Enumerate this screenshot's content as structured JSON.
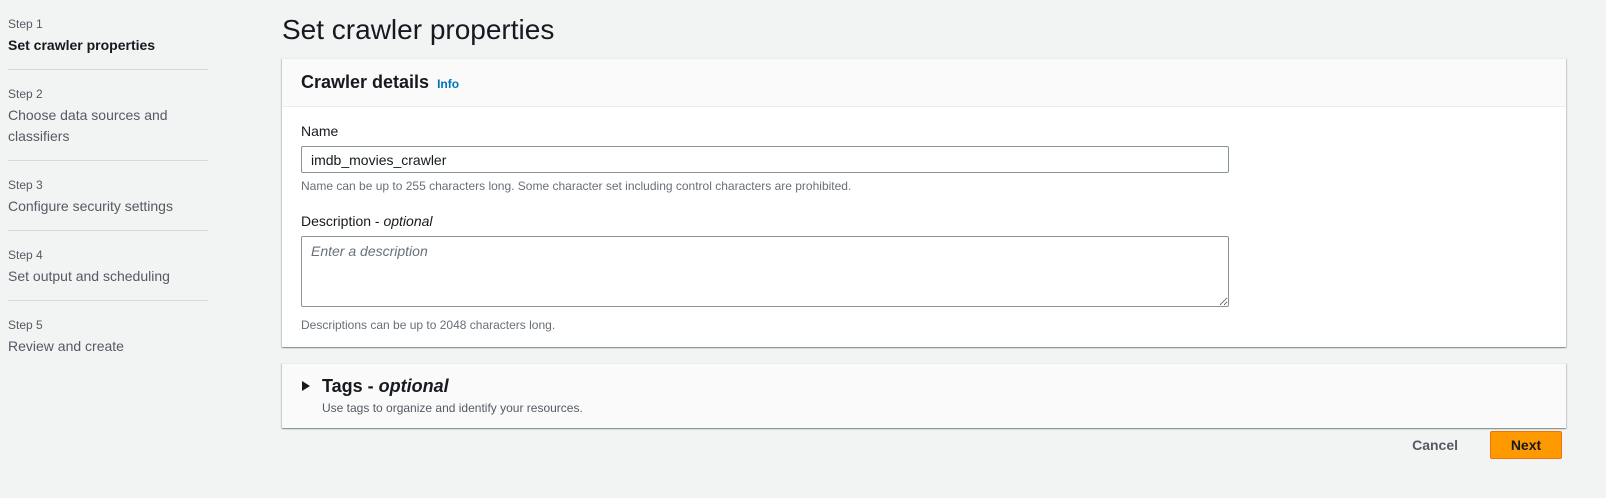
{
  "wizard": {
    "steps": [
      {
        "number": "Step 1",
        "title": "Set crawler properties",
        "active": true
      },
      {
        "number": "Step 2",
        "title": "Choose data sources and classifiers",
        "active": false
      },
      {
        "number": "Step 3",
        "title": "Configure security settings",
        "active": false
      },
      {
        "number": "Step 4",
        "title": "Set output and scheduling",
        "active": false
      },
      {
        "number": "Step 5",
        "title": "Review and create",
        "active": false
      }
    ]
  },
  "page": {
    "title": "Set crawler properties"
  },
  "crawler_details": {
    "title": "Crawler details",
    "info_label": "Info",
    "name": {
      "label": "Name",
      "value": "imdb_movies_crawler",
      "constraint": "Name can be up to 255 characters long. Some character set including control characters are prohibited."
    },
    "description": {
      "label": "Description - ",
      "label_optional": "optional",
      "placeholder": "Enter a description",
      "value": "",
      "constraint": "Descriptions can be up to 2048 characters long."
    }
  },
  "tags": {
    "title": "Tags - ",
    "title_optional": "optional",
    "description": "Use tags to organize and identify your resources.",
    "expanded": false
  },
  "actions": {
    "cancel_label": "Cancel",
    "next_label": "Next"
  },
  "colors": {
    "background": "#f2f3f3",
    "primary_button": "#ff9900",
    "link": "#0073bb",
    "text": "#16191f",
    "secondary_text": "#545b64"
  }
}
